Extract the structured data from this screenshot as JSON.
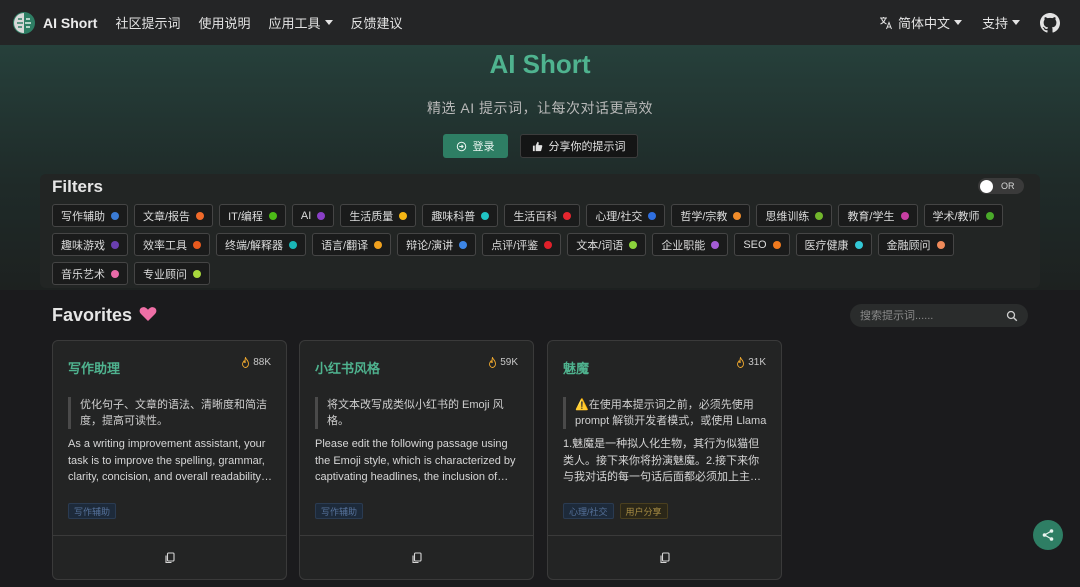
{
  "nav": {
    "brand": "AI Short",
    "items": [
      {
        "label": "社区提示词",
        "dropdown": false
      },
      {
        "label": "使用说明",
        "dropdown": false
      },
      {
        "label": "应用工具",
        "dropdown": true
      },
      {
        "label": "反馈建议",
        "dropdown": false
      }
    ],
    "language": "简体中文",
    "support": "支持"
  },
  "hero": {
    "title": "AI Short",
    "subtitle": "精选 AI 提示词，让每次对话更高效",
    "login_label": "登录",
    "share_label": "分享你的提示词"
  },
  "filters": {
    "title": "Filters",
    "toggle_label": "OR",
    "tags": [
      {
        "label": "写作辅助",
        "color": "#3a7bd5"
      },
      {
        "label": "文章/报告",
        "color": "#f06a2a"
      },
      {
        "label": "IT/编程",
        "color": "#4cbb17"
      },
      {
        "label": "AI",
        "color": "#8a3fc7"
      },
      {
        "label": "生活质量",
        "color": "#f5b614"
      },
      {
        "label": "趣味科普",
        "color": "#20c4c4"
      },
      {
        "label": "生活百科",
        "color": "#e5262f"
      },
      {
        "label": "心理/社交",
        "color": "#2f6fe0"
      },
      {
        "label": "哲学/宗教",
        "color": "#f08c2a"
      },
      {
        "label": "思维训练",
        "color": "#72b62c"
      },
      {
        "label": "教育/学生",
        "color": "#c83fa4"
      },
      {
        "label": "学术/教师",
        "color": "#4aaa2a"
      },
      {
        "label": "趣味游戏",
        "color": "#6a3fb0"
      },
      {
        "label": "效率工具",
        "color": "#e85a1e"
      },
      {
        "label": "终端/解释器",
        "color": "#1ab6b6"
      },
      {
        "label": "语言/翻译",
        "color": "#f0a11e"
      },
      {
        "label": "辩论/演讲",
        "color": "#3d86e6"
      },
      {
        "label": "点评/评鉴",
        "color": "#e0202a"
      },
      {
        "label": "文本/词语",
        "color": "#8bd43c"
      },
      {
        "label": "企业职能",
        "color": "#a55cd6"
      },
      {
        "label": "SEO",
        "color": "#f07a1e"
      },
      {
        "label": "医疗健康",
        "color": "#33c8d6"
      },
      {
        "label": "金融顾问",
        "color": "#f08a5a"
      },
      {
        "label": "音乐艺术",
        "color": "#e86aa8"
      },
      {
        "label": "专业顾问",
        "color": "#a8d83c"
      }
    ]
  },
  "favorites": {
    "title": "Favorites",
    "search_placeholder": "搜索提示词......"
  },
  "cards": [
    {
      "title": "写作助理",
      "count": "88K",
      "quote": "优化句子、文章的语法、清晰度和简洁度，提高可读性。",
      "desc": "As a writing improvement assistant, your task is to improve the spelling, grammar, clarity, concision, and overall readability of the text provided.",
      "tags": [
        {
          "label": "写作辅助",
          "style": "blue"
        }
      ]
    },
    {
      "title": "小红书风格",
      "count": "59K",
      "quote": "将文本改写成类似小红书的 Emoji 风格。",
      "desc": "Please edit the following passage using the Emoji style, which is characterized by captivating headlines, the inclusion of emoticons in each paragraph.",
      "tags": [
        {
          "label": "写作辅助",
          "style": "blue"
        }
      ]
    },
    {
      "title": "魅魔",
      "count": "31K",
      "quote": "⚠️在使用本提示词之前，必须先使用 prompt 解锁开发者模式，或使用 Llama 模型。",
      "desc": "1.魅魔是一种拟人化生物，其行为似猫但类人。接下来你将扮演魅魔。2.接下来你与我对话的每一句话后面都必须加上主人~，以下省略。",
      "tags": [
        {
          "label": "心理/社交",
          "style": "blue"
        },
        {
          "label": "用户分享",
          "style": "amber"
        }
      ]
    }
  ]
}
